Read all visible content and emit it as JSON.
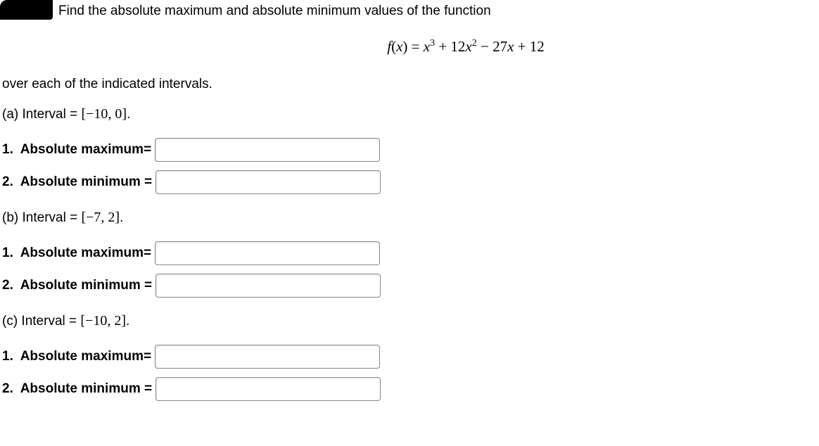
{
  "instruction": "Find the absolute maximum and absolute minimum values of the function",
  "formula_text": "f(x) = x³ + 12x² − 27x + 12",
  "sub_instruction": "over each of the indicated intervals.",
  "parts": {
    "a": {
      "label_prefix": "(a) Interval = ",
      "interval": "[−10, 0]",
      "period": ".",
      "q1_label": "1.  Absolute maximum= ",
      "q2_label": "2.  Absolute minimum = ",
      "q1_value": "",
      "q2_value": ""
    },
    "b": {
      "label_prefix": "(b) Interval = ",
      "interval": "[−7, 2]",
      "period": ".",
      "q1_label": "1.  Absolute maximum= ",
      "q2_label": "2.  Absolute minimum = ",
      "q1_value": "",
      "q2_value": ""
    },
    "c": {
      "label_prefix": "(c) Interval = ",
      "interval": "[−10, 2]",
      "period": ".",
      "q1_label": "1.  Absolute maximum= ",
      "q2_label": "2.  Absolute minimum = ",
      "q1_value": "",
      "q2_value": ""
    }
  }
}
